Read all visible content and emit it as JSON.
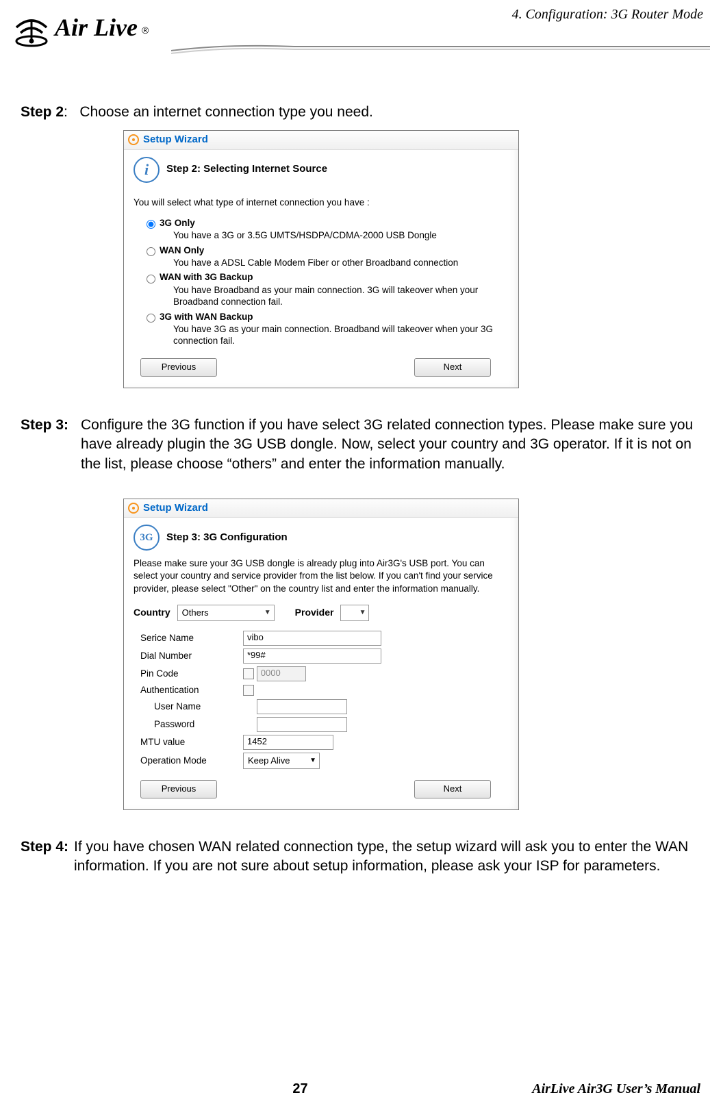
{
  "header": {
    "chapter": "4. Configuration: 3G Router Mode",
    "logo_text": "Air Live",
    "logo_r": "®"
  },
  "step2": {
    "label": "Step 2",
    "sep": ":",
    "text": "Choose an internet connection type you need."
  },
  "wizard2": {
    "title": "Setup Wizard",
    "step_header": "Step 2: Selecting Internet Source",
    "intro": "You will select what type of internet connection you have :",
    "options": [
      {
        "label": "3G Only",
        "desc": "You have a 3G or 3.5G UMTS/HSDPA/CDMA-2000 USB Dongle",
        "checked": true
      },
      {
        "label": "WAN Only",
        "desc": "You have a ADSL Cable Modem Fiber or other Broadband connection",
        "checked": false
      },
      {
        "label": "WAN with 3G Backup",
        "desc": "You have Broadband as your main connection. 3G will takeover when your Broadband connection fail.",
        "checked": false
      },
      {
        "label": "3G with WAN Backup",
        "desc": "You have 3G as your main connection. Broadband will takeover when your 3G connection fail.",
        "checked": false
      }
    ],
    "prev": "Previous",
    "next": "Next"
  },
  "step3": {
    "label": "Step 3:",
    "text": "Configure the 3G function if you have select 3G related connection types. Please make sure you have already plugin the 3G USB dongle.   Now, select your country and 3G operator.   If it is not on the list, please choose “others” and enter the information manually."
  },
  "wizard3": {
    "title": "Setup Wizard",
    "icon_text": "3G",
    "step_header": "Step 3: 3G Configuration",
    "intro": "Please make sure your 3G USB dongle is already plug into Air3G's USB port. You can select your country and service provider from the list below. If you can't find your service provider, please select \"Other\" on the country list and enter the information manually.",
    "country_label": "Country",
    "country_value": "Others",
    "provider_label": "Provider",
    "provider_value": "",
    "fields": {
      "service_label": "Serice Name",
      "service_value": "vibo",
      "dial_label": "Dial Number",
      "dial_value": "*99#",
      "pin_label": "Pin Code",
      "pin_value": "0000",
      "auth_label": "Authentication",
      "user_label": "User Name",
      "user_value": "",
      "pass_label": "Password",
      "pass_value": "",
      "mtu_label": "MTU value",
      "mtu_value": "1452",
      "opmode_label": "Operation Mode",
      "opmode_value": "Keep Alive"
    },
    "prev": "Previous",
    "next": "Next"
  },
  "step4": {
    "label": "Step 4:",
    "text": "If you have chosen WAN related connection type, the setup wizard will ask you to enter the WAN information.   If you are not sure about setup information, please ask your ISP for parameters."
  },
  "footer": {
    "page": "27",
    "manual": "AirLive Air3G User’s Manual"
  }
}
